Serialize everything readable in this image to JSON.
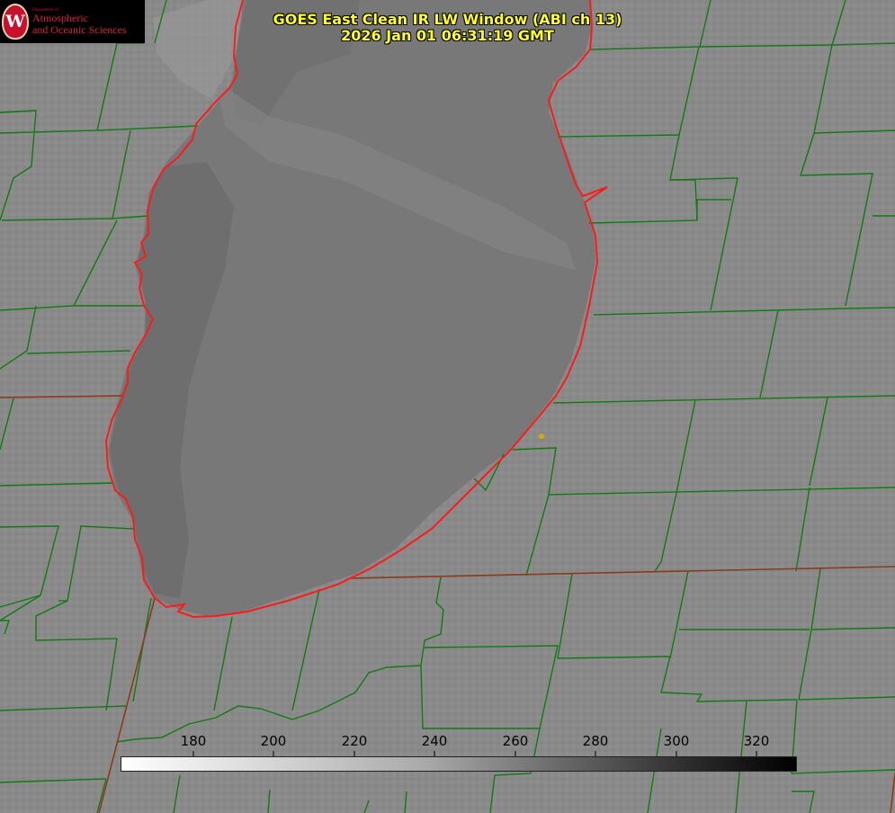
{
  "title": {
    "line1": "GOES East Clean IR LW Window (ABI ch 13)",
    "line2": "2026 Jan 01 06:31:19 GMT"
  },
  "logo": {
    "department": "Department of",
    "line1": "Atmospheric",
    "line2": "and Oceanic Sciences",
    "seal_letter": "W"
  },
  "colorbar": {
    "ticks": [
      "180",
      "200",
      "220",
      "240",
      "260",
      "280",
      "300",
      "320"
    ],
    "min": 162,
    "max": 330,
    "colormap": "grayscale, white (cold) to black (warm)"
  },
  "colors": {
    "county_lines": "#137a13",
    "state_lines": "#8b3a1a",
    "coastline": "#ff1a1a",
    "title_text": "#ffff22",
    "lake_gray": "#7a7a7a",
    "land_gray": "#898989"
  }
}
